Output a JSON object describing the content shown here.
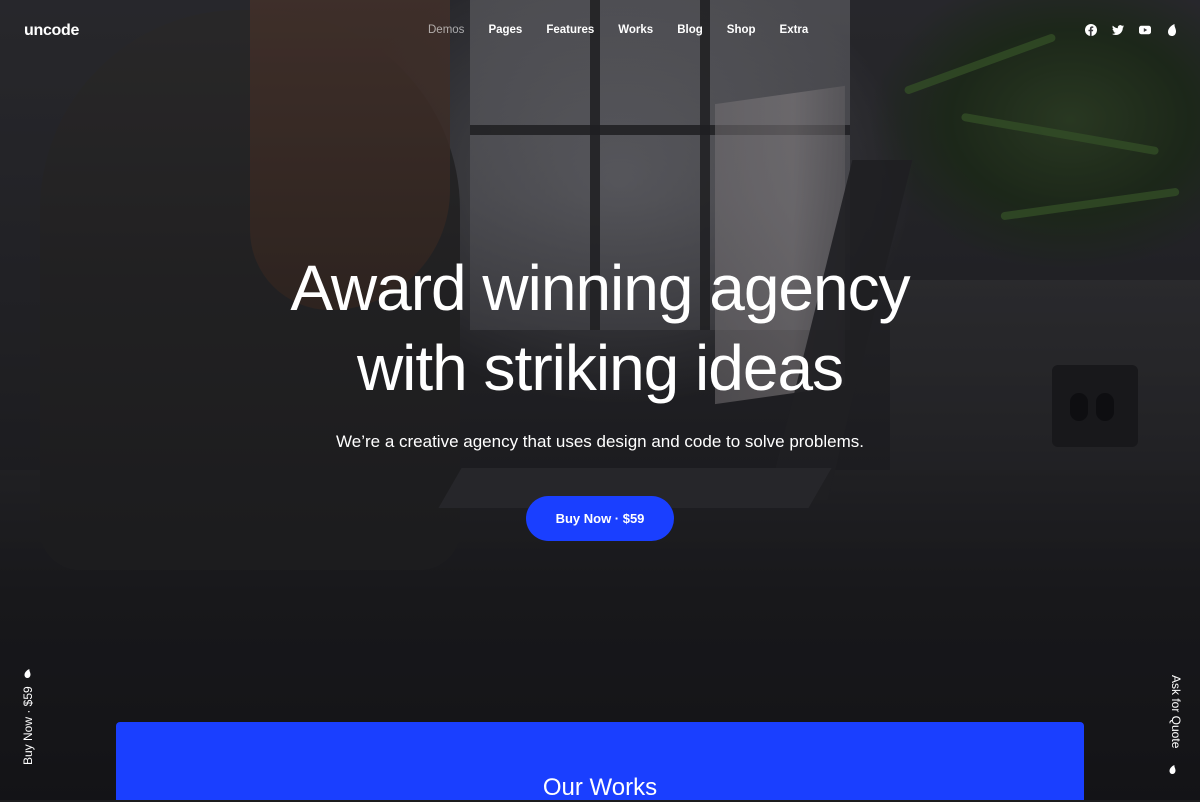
{
  "header": {
    "logo": "uncode",
    "nav": [
      "Demos",
      "Pages",
      "Features",
      "Works",
      "Blog",
      "Shop",
      "Extra"
    ],
    "social_icons": [
      "facebook-icon",
      "twitter-icon",
      "youtube-icon",
      "uncode-drop-icon"
    ]
  },
  "hero": {
    "title_line1": "Award winning agency",
    "title_line2": "with striking ideas",
    "subtitle": "We’re a creative agency that uses design and code to solve problems.",
    "cta_label": "Buy Now · $59"
  },
  "side": {
    "left_label": "Buy Now · $59",
    "right_label": "Ask for Quote"
  },
  "works": {
    "title": "Our Works"
  },
  "colors": {
    "accent": "#1a3fff",
    "text": "#ffffff"
  }
}
